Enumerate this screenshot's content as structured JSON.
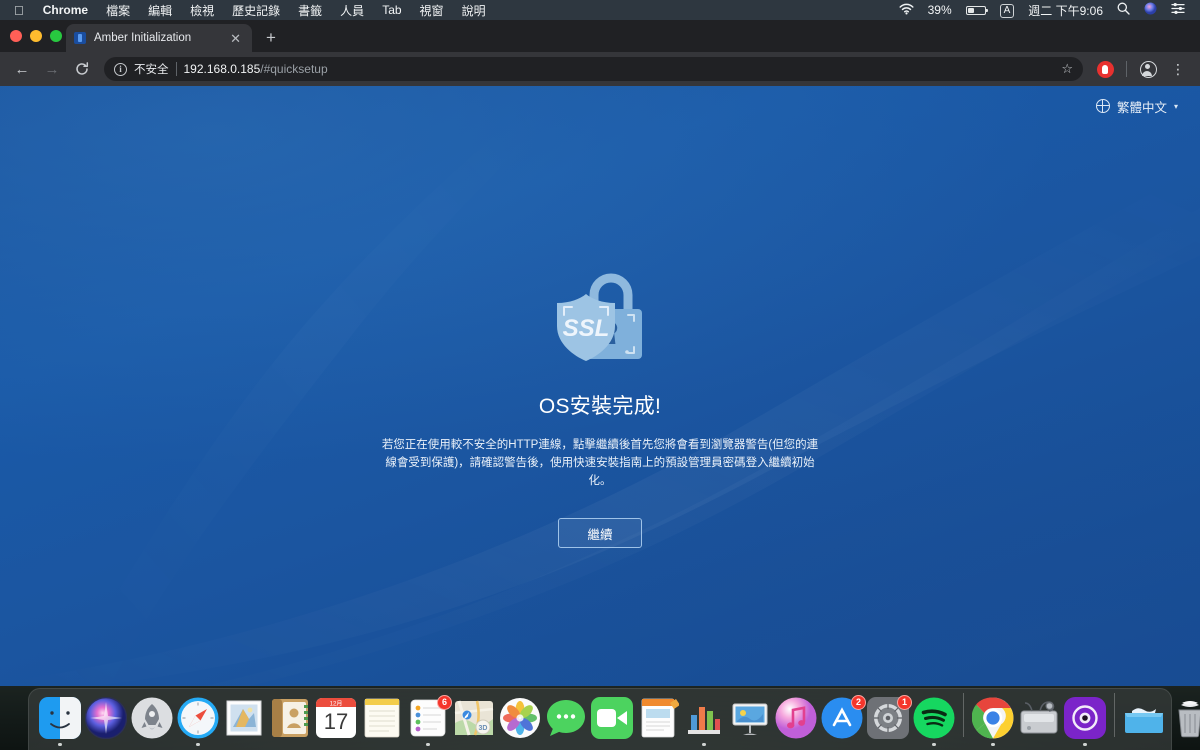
{
  "menubar": {
    "apple_icon": "apple-logo-icon",
    "app_name": "Chrome",
    "items": [
      "檔案",
      "編輯",
      "檢視",
      "歷史記錄",
      "書籤",
      "人員",
      "Tab",
      "視窗",
      "說明"
    ],
    "wifi_icon": "wifi-icon",
    "battery_percent": "39%",
    "battery_icon": "battery-icon",
    "input_source": "A",
    "clock": "週二 下午9:06",
    "search_icon": "spotlight-search-icon",
    "siri_icon": "siri-icon",
    "control_center_icon": "control-center-icon"
  },
  "browser": {
    "tab": {
      "title": "Amber Initialization",
      "favicon": "amber-favicon",
      "close_icon": "close-icon"
    },
    "new_tab_label": "+",
    "back_icon": "back-arrow-icon",
    "forward_icon": "forward-arrow-icon",
    "reload_icon": "reload-icon",
    "omnibox": {
      "security_icon": "info-circle-icon",
      "security_label": "不安全",
      "url_host": "192.168.0.185",
      "url_path": "/#quicksetup"
    },
    "bookmark_icon": "star-icon",
    "extension_icon": "extension-icon",
    "profile_icon": "profile-avatar-icon",
    "menu_icon": "three-dot-menu-icon"
  },
  "page": {
    "language": {
      "icon": "globe-icon",
      "label": "繁體中文",
      "caret": "▾"
    },
    "hero_icon": "ssl-lock-shield-icon",
    "hero_icon_text": "SSL",
    "title": "OS安裝完成!",
    "body": "若您正在使用較不安全的HTTP連線，點擊繼續後首先您將會看到瀏覽器警告(但您的連線會受到保護)，請確認警告後，使用快速安裝指南上的預設管理員密碼登入繼續初始化。",
    "continue_button": "繼續",
    "colors": {
      "background_blue": "#1a5aa8",
      "button_border": "#9fc3e8",
      "text": "#eaf1f9"
    }
  },
  "dock": {
    "items": [
      {
        "name": "finder",
        "badge": "",
        "running": true
      },
      {
        "name": "siri",
        "badge": "",
        "running": false
      },
      {
        "name": "launchpad",
        "badge": "",
        "running": false
      },
      {
        "name": "safari",
        "badge": "",
        "running": true
      },
      {
        "name": "mail",
        "badge": "",
        "running": false
      },
      {
        "name": "contacts",
        "badge": "",
        "running": false
      },
      {
        "name": "calendar",
        "badge": "",
        "running": false,
        "month": "12月",
        "day": "17"
      },
      {
        "name": "notes",
        "badge": "",
        "running": false
      },
      {
        "name": "reminders",
        "badge": "6",
        "running": true
      },
      {
        "name": "maps",
        "badge": "",
        "running": false
      },
      {
        "name": "photos",
        "badge": "",
        "running": false
      },
      {
        "name": "messages",
        "badge": "",
        "running": false
      },
      {
        "name": "facetime",
        "badge": "",
        "running": false
      },
      {
        "name": "pages",
        "badge": "",
        "running": false
      },
      {
        "name": "numbers",
        "badge": "",
        "running": true
      },
      {
        "name": "keynote",
        "badge": "",
        "running": false
      },
      {
        "name": "itunes",
        "badge": "",
        "running": false
      },
      {
        "name": "app-store",
        "badge": "2",
        "running": false
      },
      {
        "name": "system-preferences",
        "badge": "1",
        "running": false
      },
      {
        "name": "spotify",
        "badge": "",
        "running": true
      },
      {
        "name": "chrome",
        "badge": "",
        "running": true
      },
      {
        "name": "disk-utility",
        "badge": "",
        "running": false
      },
      {
        "name": "obs",
        "badge": "",
        "running": true
      },
      {
        "name": "downloads-folder",
        "badge": "",
        "running": false
      },
      {
        "name": "trash",
        "badge": "",
        "running": false
      }
    ]
  }
}
